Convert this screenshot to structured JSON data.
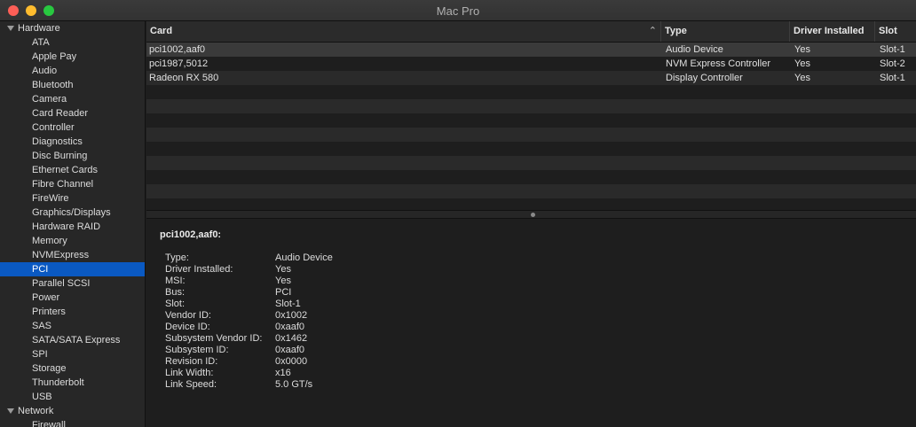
{
  "window": {
    "title": "Mac Pro"
  },
  "sidebar": {
    "groups": [
      {
        "label": "Hardware",
        "items": [
          "ATA",
          "Apple Pay",
          "Audio",
          "Bluetooth",
          "Camera",
          "Card Reader",
          "Controller",
          "Diagnostics",
          "Disc Burning",
          "Ethernet Cards",
          "Fibre Channel",
          "FireWire",
          "Graphics/Displays",
          "Hardware RAID",
          "Memory",
          "NVMExpress",
          "PCI",
          "Parallel SCSI",
          "Power",
          "Printers",
          "SAS",
          "SATA/SATA Express",
          "SPI",
          "Storage",
          "Thunderbolt",
          "USB"
        ]
      },
      {
        "label": "Network",
        "items": [
          "Firewall"
        ]
      }
    ],
    "selected": "PCI"
  },
  "table": {
    "headers": {
      "card": "Card",
      "type": "Type",
      "driver": "Driver Installed",
      "slot": "Slot"
    },
    "rows": [
      {
        "card": "pci1002,aaf0",
        "type": "Audio Device",
        "driver": "Yes",
        "slot": "Slot-1"
      },
      {
        "card": "pci1987,5012",
        "type": "NVM Express Controller",
        "driver": "Yes",
        "slot": "Slot-2"
      },
      {
        "card": "Radeon RX 580",
        "type": "Display Controller",
        "driver": "Yes",
        "slot": "Slot-1"
      }
    ]
  },
  "detail": {
    "title": "pci1002,aaf0:",
    "fields": [
      {
        "key": "Type:",
        "value": "Audio Device"
      },
      {
        "key": "Driver Installed:",
        "value": "Yes"
      },
      {
        "key": "MSI:",
        "value": "Yes"
      },
      {
        "key": "Bus:",
        "value": "PCI"
      },
      {
        "key": "Slot:",
        "value": "Slot-1"
      },
      {
        "key": "Vendor ID:",
        "value": "0x1002"
      },
      {
        "key": "Device ID:",
        "value": "0xaaf0"
      },
      {
        "key": "Subsystem Vendor ID:",
        "value": "0x1462"
      },
      {
        "key": "Subsystem ID:",
        "value": "0xaaf0"
      },
      {
        "key": "Revision ID:",
        "value": "0x0000"
      },
      {
        "key": "Link Width:",
        "value": "x16"
      },
      {
        "key": "Link Speed:",
        "value": "5.0 GT/s"
      }
    ]
  }
}
